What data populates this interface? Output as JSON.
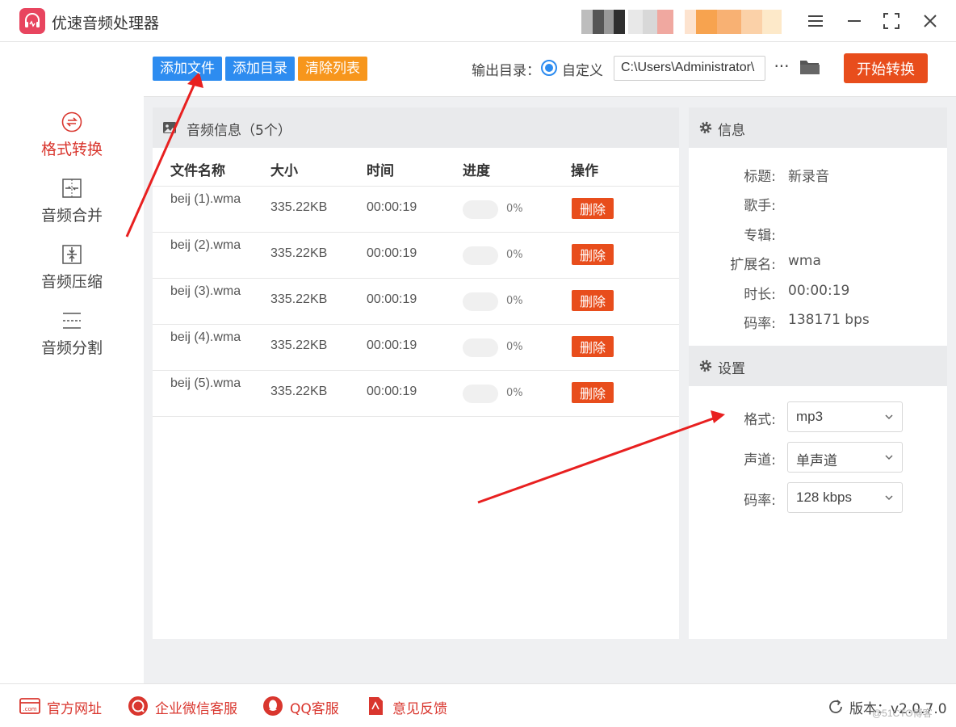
{
  "app": {
    "title": "优速音频处理器",
    "window_controls": [
      "menu-icon",
      "minimize-icon",
      "maximize-icon",
      "close-icon"
    ]
  },
  "sidebar": {
    "items": [
      {
        "label": "格式转换",
        "icon": "format-convert-icon",
        "active": true
      },
      {
        "label": "音频合并",
        "icon": "merge-icon",
        "active": false
      },
      {
        "label": "音频压缩",
        "icon": "compress-icon",
        "active": false
      },
      {
        "label": "音频分割",
        "icon": "split-icon",
        "active": false
      }
    ]
  },
  "toolbar": {
    "add_file": "添加文件",
    "add_dir": "添加目录",
    "clear_list": "清除列表",
    "output_label": "输出目录：",
    "output_option": "自定义",
    "output_path": "C:\\Users\\Administrator\\",
    "more": "···",
    "start": "开始转换"
  },
  "file_list": {
    "title": "音频信息（5个）",
    "columns": [
      "文件名称",
      "大小",
      "时间",
      "进度",
      "操作"
    ],
    "delete_label": "删除",
    "rows": [
      {
        "name": "beij (1).wma",
        "size": "335.22KB",
        "time": "00:00:19",
        "progress": 0,
        "progress_text": "0%"
      },
      {
        "name": "beij (2).wma",
        "size": "335.22KB",
        "time": "00:00:19",
        "progress": 0,
        "progress_text": "0%"
      },
      {
        "name": "beij (3).wma",
        "size": "335.22KB",
        "time": "00:00:19",
        "progress": 0,
        "progress_text": "0%"
      },
      {
        "name": "beij (4).wma",
        "size": "335.22KB",
        "time": "00:00:19",
        "progress": 0,
        "progress_text": "0%"
      },
      {
        "name": "beij (5).wma",
        "size": "335.22KB",
        "time": "00:00:19",
        "progress": 0,
        "progress_text": "0%"
      }
    ]
  },
  "info": {
    "title": "信息",
    "fields": [
      {
        "label": "标题:",
        "value": "新录音"
      },
      {
        "label": "歌手:",
        "value": ""
      },
      {
        "label": "专辑:",
        "value": ""
      },
      {
        "label": "扩展名:",
        "value": "wma"
      },
      {
        "label": "时长:",
        "value": "00:00:19"
      },
      {
        "label": "码率:",
        "value": "138171 bps"
      }
    ]
  },
  "settings": {
    "title": "设置",
    "fields": [
      {
        "label": "格式:",
        "value": "mp3"
      },
      {
        "label": "声道:",
        "value": "单声道"
      },
      {
        "label": "码率:",
        "value": "128 kbps"
      }
    ]
  },
  "footer": {
    "links": [
      {
        "label": "官方网址",
        "icon": "website-icon"
      },
      {
        "label": "企业微信客服",
        "icon": "wechat-service-icon"
      },
      {
        "label": "QQ客服",
        "icon": "qq-icon"
      },
      {
        "label": "意见反馈",
        "icon": "feedback-icon"
      }
    ],
    "version": "版本：v2.0.7.0"
  },
  "watermark": "@51CTO博客",
  "colors": {
    "accent_red": "#e84d1c",
    "blue": "#2d8cf0",
    "orange": "#f7961c",
    "active_red": "#d9362e"
  }
}
